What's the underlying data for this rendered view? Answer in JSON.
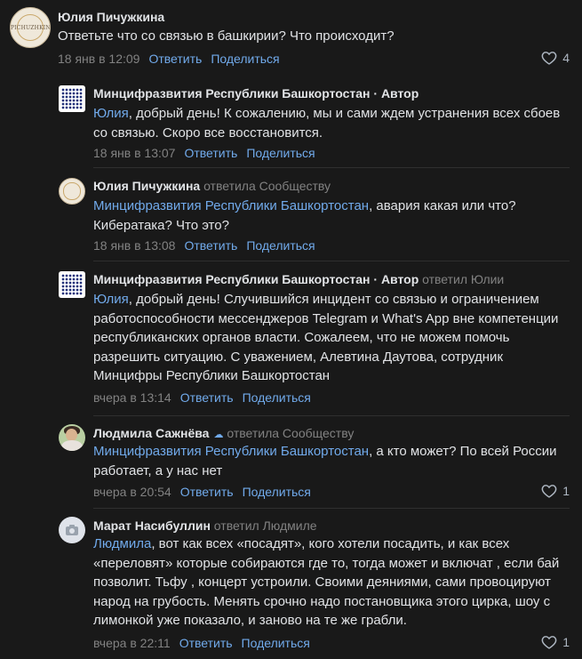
{
  "comments": [
    {
      "author": "Юлия Пичужкина",
      "avatar_text": "PICHUZHKINA",
      "text": "Ответьте что со связью в башкирии? Что происходит?",
      "date": "18 янв в 12:09",
      "reply_label": "Ответить",
      "share_label": "Поделиться",
      "likes": "4"
    },
    {
      "author": "Минцифразвития Республики Башкортостан",
      "role": " · Автор",
      "mention": "Юлия",
      "text": ", добрый день! К сожалению, мы и сами ждем устранения всех сбоев со связью. Скоро все восстановится.",
      "date": "18 янв в 13:07",
      "reply_label": "Ответить",
      "share_label": "Поделиться"
    },
    {
      "author": "Юлия Пичужкина",
      "avatar_text": "PICHUZHKINA",
      "reply_to": "ответила Сообществу",
      "mention": "Минцифразвития Республики Башкортостан",
      "text": ", авария какая или что? Кибератака? Что это?",
      "date": "18 янв в 13:08",
      "reply_label": "Ответить",
      "share_label": "Поделиться"
    },
    {
      "author": "Минцифразвития Республики Башкортостан",
      "role": " · Автор",
      "reply_to": "ответил Юлии",
      "mention": "Юлия",
      "text": ", добрый день! Случившийся инцидент со связью и ограничением работоспособности мессенджеров Telegram и What's App вне компетенции республиканских органов власти. Сожалеем, что не можем помочь разрешить ситуацию. С уважением, Алевтина Даутова, сотрудник Минцифры Республики Башкортостан",
      "date": "вчера в 13:14",
      "reply_label": "Ответить",
      "share_label": "Поделиться"
    },
    {
      "author": "Людмила Сажнёва",
      "reply_to": "ответила Сообществу",
      "mention": "Минцифразвития Республики Башкортостан",
      "text": ", а кто может? По всей России работает, а у нас нет",
      "date": "вчера в 20:54",
      "reply_label": "Ответить",
      "share_label": "Поделиться",
      "likes": "1"
    },
    {
      "author": "Марат Насибуллин",
      "reply_to": "ответил Людмиле",
      "mention": "Людмила",
      "text": ", вот как всех «посадят», кого хотели посадить, и как всех «переловят» которые собираются где то, тогда может и включат , если бай позволит. Тьфу , концерт устроили. Своими деяниями, сами провоцируют народ на грубость. Менять срочно надо постановщика этого цирка, шоу с лимонкой уже показало, и заново на те же грабли.",
      "date": "вчера в 22:11",
      "reply_label": "Ответить",
      "share_label": "Поделиться",
      "likes": "1"
    }
  ],
  "colors": {
    "background": "#191919",
    "text": "#e1e3e6",
    "link": "#71aaeb",
    "muted": "#828282"
  },
  "icons": [
    "heart-icon",
    "camera-icon",
    "badge-icon"
  ]
}
